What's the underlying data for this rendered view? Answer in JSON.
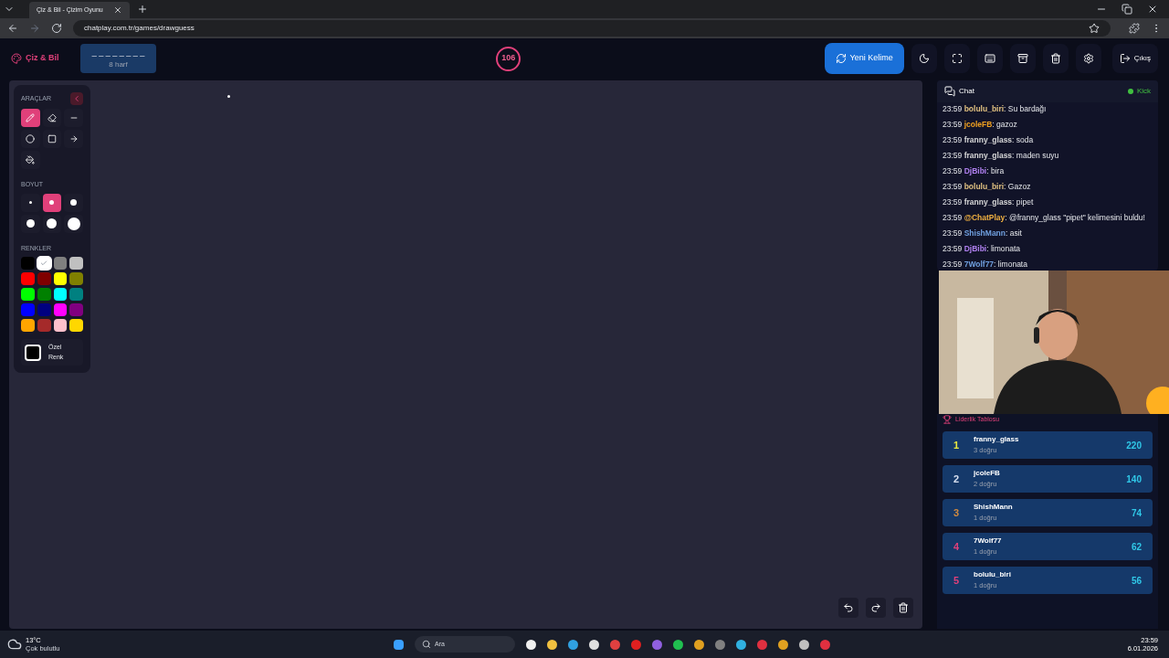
{
  "browser": {
    "tab_title": "Çiz & Bil - Çizim Oyunu",
    "url": "chatplay.com.tr/games/drawguess"
  },
  "header": {
    "logo": "Çiz & Bil",
    "word_mask": "_ _ _ _ _ _ _ _",
    "word_hint": "8 harf",
    "timer": "106",
    "new_word": "Yeni Kelime",
    "exit": "Çıkış"
  },
  "tools": {
    "title": "ARAÇLAR",
    "items": [
      {
        "kind": "pencil",
        "selected": true
      },
      {
        "kind": "eraser",
        "selected": false
      },
      {
        "kind": "line",
        "selected": false
      },
      {
        "kind": "circle",
        "selected": false
      },
      {
        "kind": "rect",
        "selected": false
      },
      {
        "kind": "arrow",
        "selected": false
      },
      {
        "kind": "fill",
        "selected": false
      }
    ],
    "size_title": "BOYUT",
    "sizes": [
      {
        "selected": false
      },
      {
        "selected": true
      },
      {
        "selected": false
      },
      {
        "selected": false
      },
      {
        "selected": false
      },
      {
        "selected": false
      }
    ],
    "colors_title": "RENKLER",
    "colors": [
      {
        "color": "#000000",
        "selected": false
      },
      {
        "color": "#ffffff",
        "selected": true
      },
      {
        "color": "#808080",
        "selected": false
      },
      {
        "color": "#c0c0c0",
        "selected": false
      },
      {
        "color": "#ff0000",
        "selected": false
      },
      {
        "color": "#800000",
        "selected": false
      },
      {
        "color": "#ffff00",
        "selected": false
      },
      {
        "color": "#808000",
        "selected": false
      },
      {
        "color": "#00ff00",
        "selected": false
      },
      {
        "color": "#008000",
        "selected": false
      },
      {
        "color": "#00ffff",
        "selected": false
      },
      {
        "color": "#008080",
        "selected": false
      },
      {
        "color": "#0000ff",
        "selected": false
      },
      {
        "color": "#000080",
        "selected": false
      },
      {
        "color": "#ff00ff",
        "selected": false
      },
      {
        "color": "#800080",
        "selected": false
      },
      {
        "color": "#ffa500",
        "selected": false
      },
      {
        "color": "#a52a2a",
        "selected": false
      },
      {
        "color": "#ffc0cb",
        "selected": false
      },
      {
        "color": "#ffd700",
        "selected": false
      }
    ],
    "custom_color": "Özel Renk"
  },
  "chat": {
    "title": "Chat",
    "platform": "Kick",
    "messages": [
      {
        "time": "23:59",
        "user": "bolulu_biri",
        "color": "#e0c080",
        "text": ": Su bardağı"
      },
      {
        "time": "23:59",
        "user": "jcoleFB",
        "color": "#f0a020",
        "text": ": gazoz"
      },
      {
        "time": "23:59",
        "user": "franny_glass",
        "color": "#d8d8d8",
        "text": ": soda"
      },
      {
        "time": "23:59",
        "user": "franny_glass",
        "color": "#d8d8d8",
        "text": ": maden suyu"
      },
      {
        "time": "23:59",
        "user": "DjBibi",
        "color": "#b080f0",
        "text": ": bira"
      },
      {
        "time": "23:59",
        "user": "bolulu_biri",
        "color": "#e0c080",
        "text": ": Gazoz"
      },
      {
        "time": "23:59",
        "user": "franny_glass",
        "color": "#d8d8d8",
        "text": ": pipet"
      },
      {
        "time": "23:59",
        "user": "@ChatPlay",
        "color": "#f0b040",
        "text": ": @franny_glass \"pipet\" kelimesini buldu!"
      },
      {
        "time": "23:59",
        "user": "ShishMann",
        "color": "#70a0e0",
        "text": ": asit"
      },
      {
        "time": "23:59",
        "user": "DjBibi",
        "color": "#b080f0",
        "text": ": limonata"
      },
      {
        "time": "23:59",
        "user": "7Wolf77",
        "color": "#70a0e0",
        "text": ": limonata"
      }
    ]
  },
  "leaderboard": {
    "title": "Liderlik Tablosu",
    "rows": [
      {
        "rank": "1",
        "color": "#e8e840",
        "name": "franny_glass",
        "sub": "3 doğru",
        "score": "220"
      },
      {
        "rank": "2",
        "color": "#d8e0f0",
        "name": "jcoleFB",
        "sub": "2 doğru",
        "score": "140"
      },
      {
        "rank": "3",
        "color": "#d08a40",
        "name": "ShishMann",
        "sub": "1 doğru",
        "score": "74"
      },
      {
        "rank": "4",
        "color": "#e0407a",
        "name": "7Wolf77",
        "sub": "1 doğru",
        "score": "62"
      },
      {
        "rank": "5",
        "color": "#e0407a",
        "name": "bolulu_biri",
        "sub": "1 doğru",
        "score": "56"
      }
    ]
  },
  "taskbar": {
    "temp": "13°C",
    "weather": "Çok bulutlu",
    "search": "Ara",
    "time": "23:59",
    "date": "6.01.2026"
  }
}
